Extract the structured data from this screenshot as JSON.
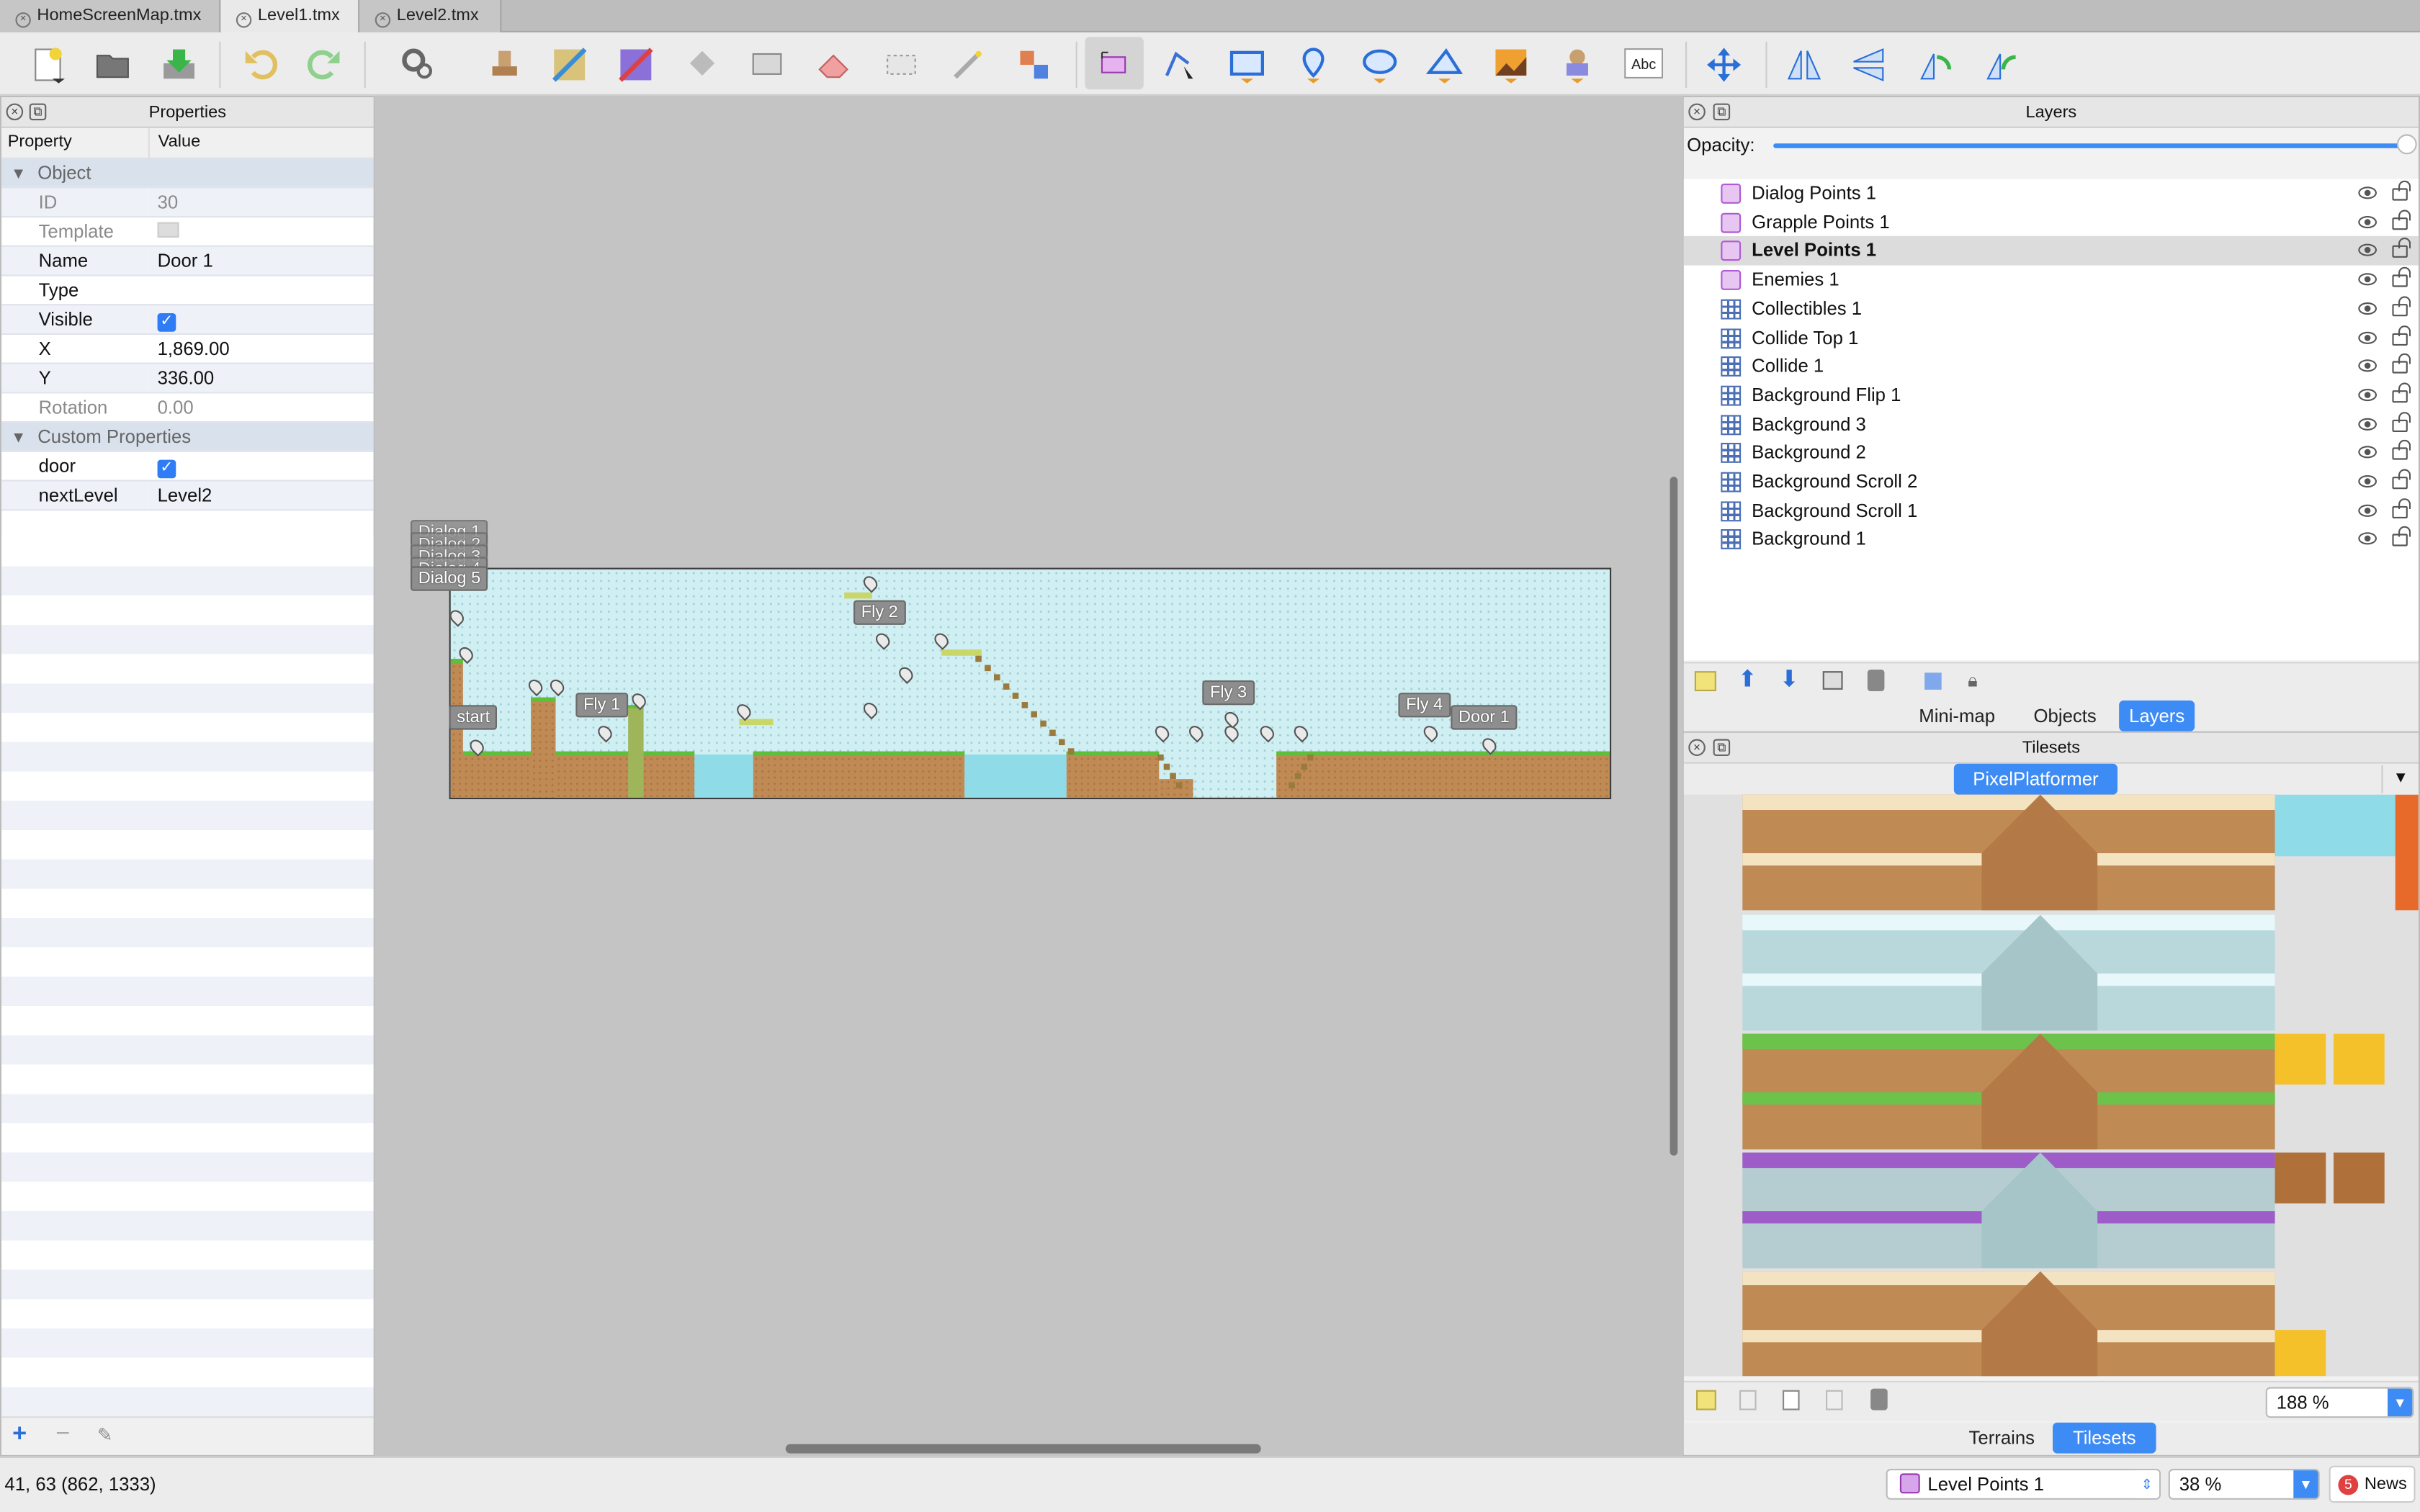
{
  "tabs": [
    {
      "label": "HomeScreenMap.tmx"
    },
    {
      "label": "Level1.tmx"
    },
    {
      "label": "Level2.tmx"
    }
  ],
  "properties": {
    "title": "Properties",
    "col_property": "Property",
    "col_value": "Value",
    "group_object": "Object",
    "rows": [
      {
        "name": "ID",
        "value": "30"
      },
      {
        "name": "Template",
        "value": ""
      },
      {
        "name": "Name",
        "value": "Door 1"
      },
      {
        "name": "Type",
        "value": ""
      },
      {
        "name": "Visible",
        "value": "checked"
      },
      {
        "name": "X",
        "value": "1,869.00"
      },
      {
        "name": "Y",
        "value": "336.00"
      },
      {
        "name": "Rotation",
        "value": "0.00"
      }
    ],
    "group_custom": "Custom Properties",
    "custom_rows": [
      {
        "name": "door",
        "value": "checked"
      },
      {
        "name": "nextLevel",
        "value": "Level2"
      }
    ]
  },
  "map": {
    "labels": [
      "Dialog 1",
      "Dialog 2",
      "Dialog 3",
      "Dialog 4",
      "Dialog 5",
      "start",
      "Fly 1",
      "Fly 2",
      "Fly 3",
      "Fly 4",
      "Door 1"
    ]
  },
  "layers": {
    "title": "Layers",
    "opacity_label": "Opacity:",
    "opacity_value": 1.0,
    "items": [
      {
        "name": "Dialog Points 1",
        "kind": "object"
      },
      {
        "name": "Grapple Points 1",
        "kind": "object"
      },
      {
        "name": "Level Points 1",
        "kind": "object",
        "selected": true
      },
      {
        "name": "Enemies 1",
        "kind": "object"
      },
      {
        "name": "Collectibles 1",
        "kind": "tile"
      },
      {
        "name": "Collide Top 1",
        "kind": "tile"
      },
      {
        "name": "Collide 1",
        "kind": "tile"
      },
      {
        "name": "Background Flip 1",
        "kind": "tile"
      },
      {
        "name": "Background 3",
        "kind": "tile"
      },
      {
        "name": "Background 2",
        "kind": "tile"
      },
      {
        "name": "Background Scroll 2",
        "kind": "tile"
      },
      {
        "name": "Background Scroll 1",
        "kind": "tile"
      },
      {
        "name": "Background 1",
        "kind": "tile"
      }
    ],
    "view_tabs": [
      "Mini-map",
      "Objects",
      "Layers"
    ]
  },
  "tilesets": {
    "title": "Tilesets",
    "tileset_tab": "PixelPlatformer",
    "zoom": "188 %",
    "bottom_tabs": [
      "Terrains",
      "Tilesets"
    ]
  },
  "status": {
    "coords": "41, 63 (862, 1333)",
    "current_layer": "Level Points 1",
    "zoom": "38 %",
    "news_count": "5",
    "news_label": "News"
  },
  "colors": {
    "accent": "#3d8bf5",
    "object_layer_icon": "#b05ad6",
    "tile_layer_icon": "#4a6fb5",
    "grass": "#5fbf3a",
    "dirt": "#c08a55",
    "water": "#8fdbe8",
    "sky": "#cfeff2"
  }
}
